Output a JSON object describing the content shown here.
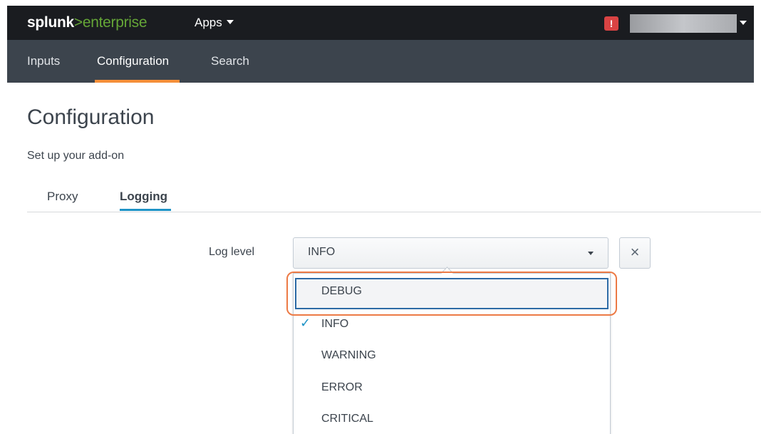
{
  "header": {
    "logo_brand": "splunk",
    "logo_gt": ">",
    "logo_product": "enterprise",
    "apps_label": "Apps",
    "alert_label": "!"
  },
  "nav": {
    "items": [
      {
        "label": "Inputs"
      },
      {
        "label": "Configuration"
      },
      {
        "label": "Search"
      }
    ],
    "active": "Configuration"
  },
  "page": {
    "title": "Configuration",
    "subtitle": "Set up your add-on",
    "tabs": [
      {
        "label": "Proxy"
      },
      {
        "label": "Logging"
      }
    ],
    "active_tab": "Logging"
  },
  "form": {
    "log_level_label": "Log level",
    "log_level_value": "INFO",
    "clear_label": "×"
  },
  "dropdown": {
    "options": [
      "DEBUG",
      "INFO",
      "WARNING",
      "ERROR",
      "CRITICAL"
    ],
    "checked": "INFO",
    "highlighted": "DEBUG",
    "check_glyph": "✓"
  },
  "colors": {
    "topbar": "#1a1c20",
    "navbar": "#3c444d",
    "brand_green": "#65a637",
    "accent_orange": "#f58f39",
    "tab_blue": "#1e93c6",
    "highlight_outline": "#ec7a45",
    "alert_red": "#d94343"
  },
  "icons": {
    "alert": "alert-icon",
    "clear": "close-icon",
    "caret": "chevron-down-icon",
    "check": "check-icon"
  }
}
